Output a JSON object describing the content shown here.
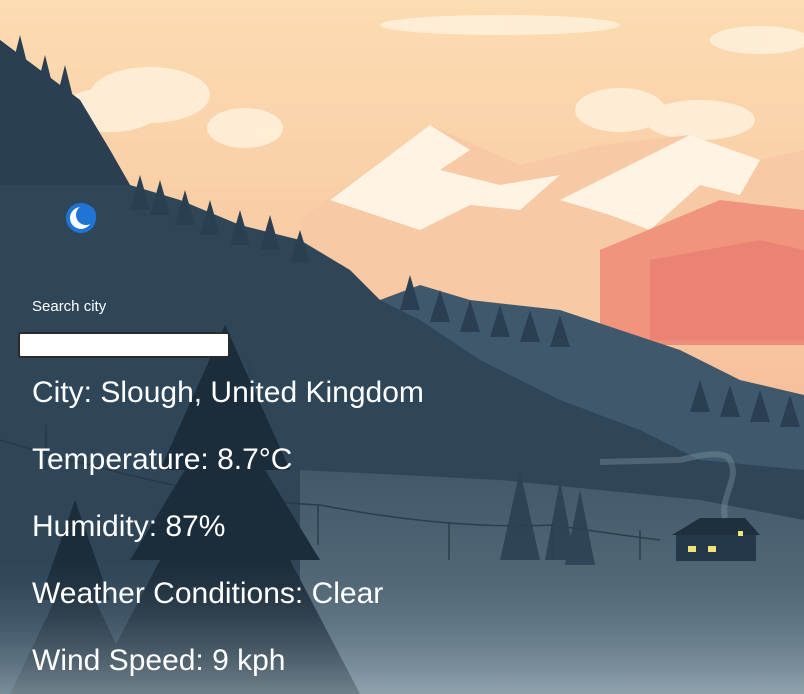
{
  "search": {
    "label": "Search city",
    "value": "",
    "placeholder": ""
  },
  "weather": {
    "icon": "crescent-moon-icon",
    "city": "City: Slough, United Kingdom",
    "temperature": "Temperature: 8.7°C",
    "humidity": "Humidity: 87%",
    "conditions": "Weather Conditions: Clear",
    "wind_speed": "Wind Speed: 9 kph"
  },
  "colors": {
    "text": "#ffffff",
    "sky_top": "#fbd8ae",
    "sky_bottom": "#f6a98c",
    "forest": "#2e4557",
    "moon_icon": "#1f74d6"
  }
}
